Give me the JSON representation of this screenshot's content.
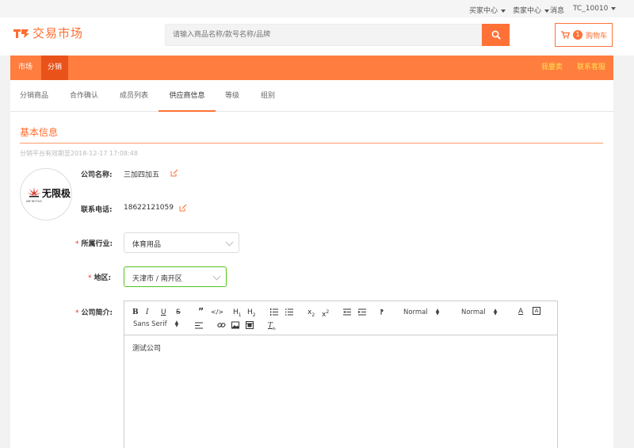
{
  "topbar": {
    "buyer_center": "买家中心",
    "seller_center": "卖家中心",
    "messages": "消息",
    "user": "TC_10010"
  },
  "header": {
    "logo_text": "交易市场",
    "search_placeholder": "请输入商品名称/款号名称/品牌",
    "cart_count": "1",
    "cart_label": "购物车",
    "brand_color": "#ff7137"
  },
  "nav": {
    "items": [
      {
        "label": "市场"
      },
      {
        "label": "分销"
      }
    ],
    "right": {
      "sell": "我要卖",
      "support": "联系客服"
    }
  },
  "tabs": [
    {
      "label": "分销商品"
    },
    {
      "label": "合作确认"
    },
    {
      "label": "成员列表"
    },
    {
      "label": "供应商信息",
      "active": true
    },
    {
      "label": "等级"
    },
    {
      "label": "组别"
    }
  ],
  "basic_info": {
    "title": "基本信息",
    "validity": "分销平台有效期至2018-12-17 17:08:48",
    "logo_text": "无限极",
    "logo_subtext": "INFINITUS"
  },
  "form": {
    "company_name_label": "公司名称:",
    "company_name": "三加四加五",
    "phone_label": "联系电话:",
    "phone": "18622121059",
    "industry_label": "所属行业:",
    "industry": "体育用品",
    "region_label": "地区:",
    "region": "天津市 / 南开区",
    "intro_label": "公司简介:"
  },
  "editor": {
    "header_select": "Normal",
    "size_select": "Normal",
    "font_select": "Sans Serif",
    "content": "测试公司"
  }
}
